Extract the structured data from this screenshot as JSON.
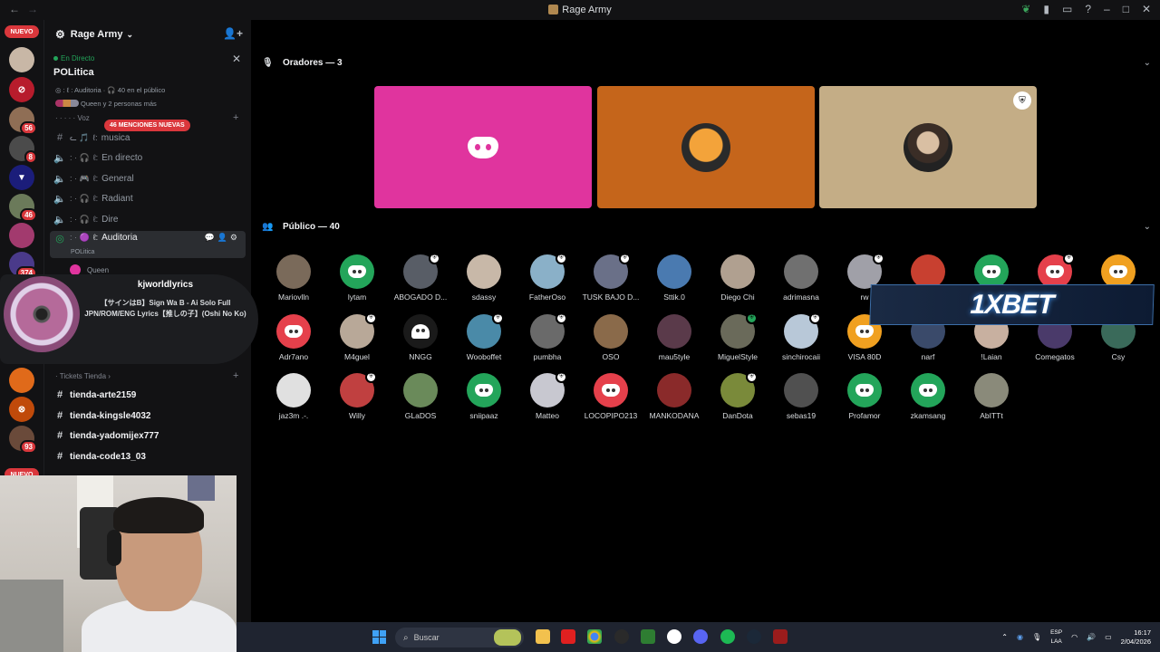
{
  "window": {
    "title": "Rage Army"
  },
  "guilds": {
    "new_top": "NUEVO",
    "new_bottom": "NUEVO",
    "badges": [
      "56",
      "8",
      "46",
      "374",
      "93"
    ]
  },
  "server": {
    "name": "Rage Army"
  },
  "stage": {
    "live_label": "En Directo",
    "title": "POLitica",
    "info": "ℓ : Auditoria · 🎧 40 en el público",
    "people": "Queen y 2 personas más"
  },
  "categories": {
    "voice": "Voz",
    "tickets": "Tickets Tienda"
  },
  "mentions_pill": "46 MENCIONES NUEVAS",
  "channels": [
    {
      "prefix": "ℓ:",
      "label": "musica"
    },
    {
      "prefix": "ℓ:",
      "label": "En directo"
    },
    {
      "prefix": "ℓ:",
      "label": "General"
    },
    {
      "prefix": "ℓ:",
      "label": "Radiant"
    },
    {
      "prefix": "ℓ:",
      "label": "Dire"
    },
    {
      "prefix": "ℓ:",
      "label": "Auditoria"
    }
  ],
  "active_sub": "POLitica",
  "voice_users": [
    "Queen",
    "m"
  ],
  "activity": {
    "user": "kjworldlyrics",
    "description": "【サインはB】Sign Wa B - Ai Solo Full JPN/ROM/ENG Lyrics【推しの子】(Oshi No Ko)"
  },
  "ticket_channels": [
    "tienda-arte2159",
    "tienda-kingsle4032",
    "tienda-yadomijex777",
    "tienda-code13_03"
  ],
  "speakers_header": "Oradores — 3",
  "audience_header": "Público — 40",
  "audience": [
    [
      "Mariovlln",
      "lytam",
      "ABOGADO D...",
      "sdassy",
      "FatherOso",
      "TUSK BAJO D...",
      "Sttik.0",
      "Diego Chi",
      "adrimasna",
      "rw",
      "",
      "",
      "",
      ""
    ],
    [
      "Adr7ano",
      "M4guel",
      "NNGG",
      "Wooboffet",
      "pumbha",
      "OSO",
      "mau5tyle",
      "MiguelStyle",
      "sinchirocaii",
      "VISA 80D",
      "narf",
      "!Laian",
      "Comegatos",
      "Csy"
    ],
    [
      "jaz3m .-.",
      "Willy",
      "GLaDOS",
      "sniipaaz",
      "Matteo",
      "LOCOPIPO213",
      "MANKODANA",
      "DanDota",
      "sebas19",
      "Profamor",
      "zkamsang",
      "AbITTt"
    ]
  ],
  "ad": {
    "text": "1XBET"
  },
  "taskbar": {
    "search_placeholder": "Buscar",
    "lang_top": "ESP",
    "lang_bottom": "LAA",
    "time": "16:17",
    "date": "2/04/2026"
  }
}
